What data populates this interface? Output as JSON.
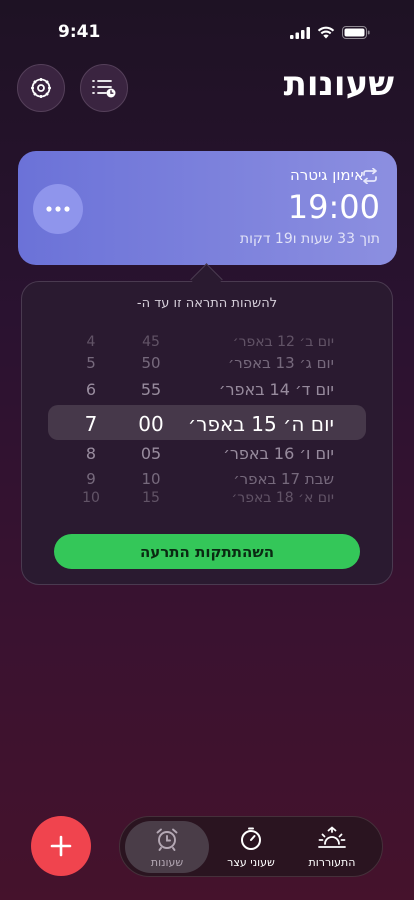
{
  "status": {
    "time": "9:41"
  },
  "header": {
    "title": "שעונות",
    "settings_icon": "gear-icon",
    "list_icon": "list-clock-icon"
  },
  "alarm": {
    "label": "אימון גיטרה",
    "time": "19:00",
    "subtitle": "תוך 33 שעות ו19 דקות",
    "repeat_icon": "repeat-icon",
    "more_icon": "ellipsis-icon"
  },
  "snooze_picker": {
    "title": "להשהות התראה זו עד ה-",
    "rows": [
      {
        "hour": "4",
        "minute": "45",
        "day": "יום ב׳ 12 באפר׳"
      },
      {
        "hour": "5",
        "minute": "50",
        "day": "יום ג׳ 13 באפר׳"
      },
      {
        "hour": "6",
        "minute": "55",
        "day": "יום ד׳ 14 באפר׳"
      },
      {
        "hour": "7",
        "minute": "00",
        "day": "יום ה׳ 15 באפר׳"
      },
      {
        "hour": "8",
        "minute": "05",
        "day": "יום ו׳ 16 באפר׳"
      },
      {
        "hour": "9",
        "minute": "10",
        "day": "שבת 17 באפר׳"
      },
      {
        "hour": "10",
        "minute": "15",
        "day": "יום א׳ 18 באפר׳"
      }
    ],
    "selected_index": 3,
    "button_label": "השהתתקות התרעה"
  },
  "tabs": [
    {
      "label": "שעונות",
      "icon": "alarm-clock-icon",
      "active": true
    },
    {
      "label": "שעוני עצר",
      "icon": "stopwatch-icon",
      "active": false
    },
    {
      "label": "התעוררות",
      "icon": "sunrise-icon",
      "active": false
    }
  ],
  "add_icon": "plus-icon",
  "colors": {
    "accent_green": "#34c759",
    "accent_red": "#f0444e",
    "card": "#7a7fdc"
  }
}
